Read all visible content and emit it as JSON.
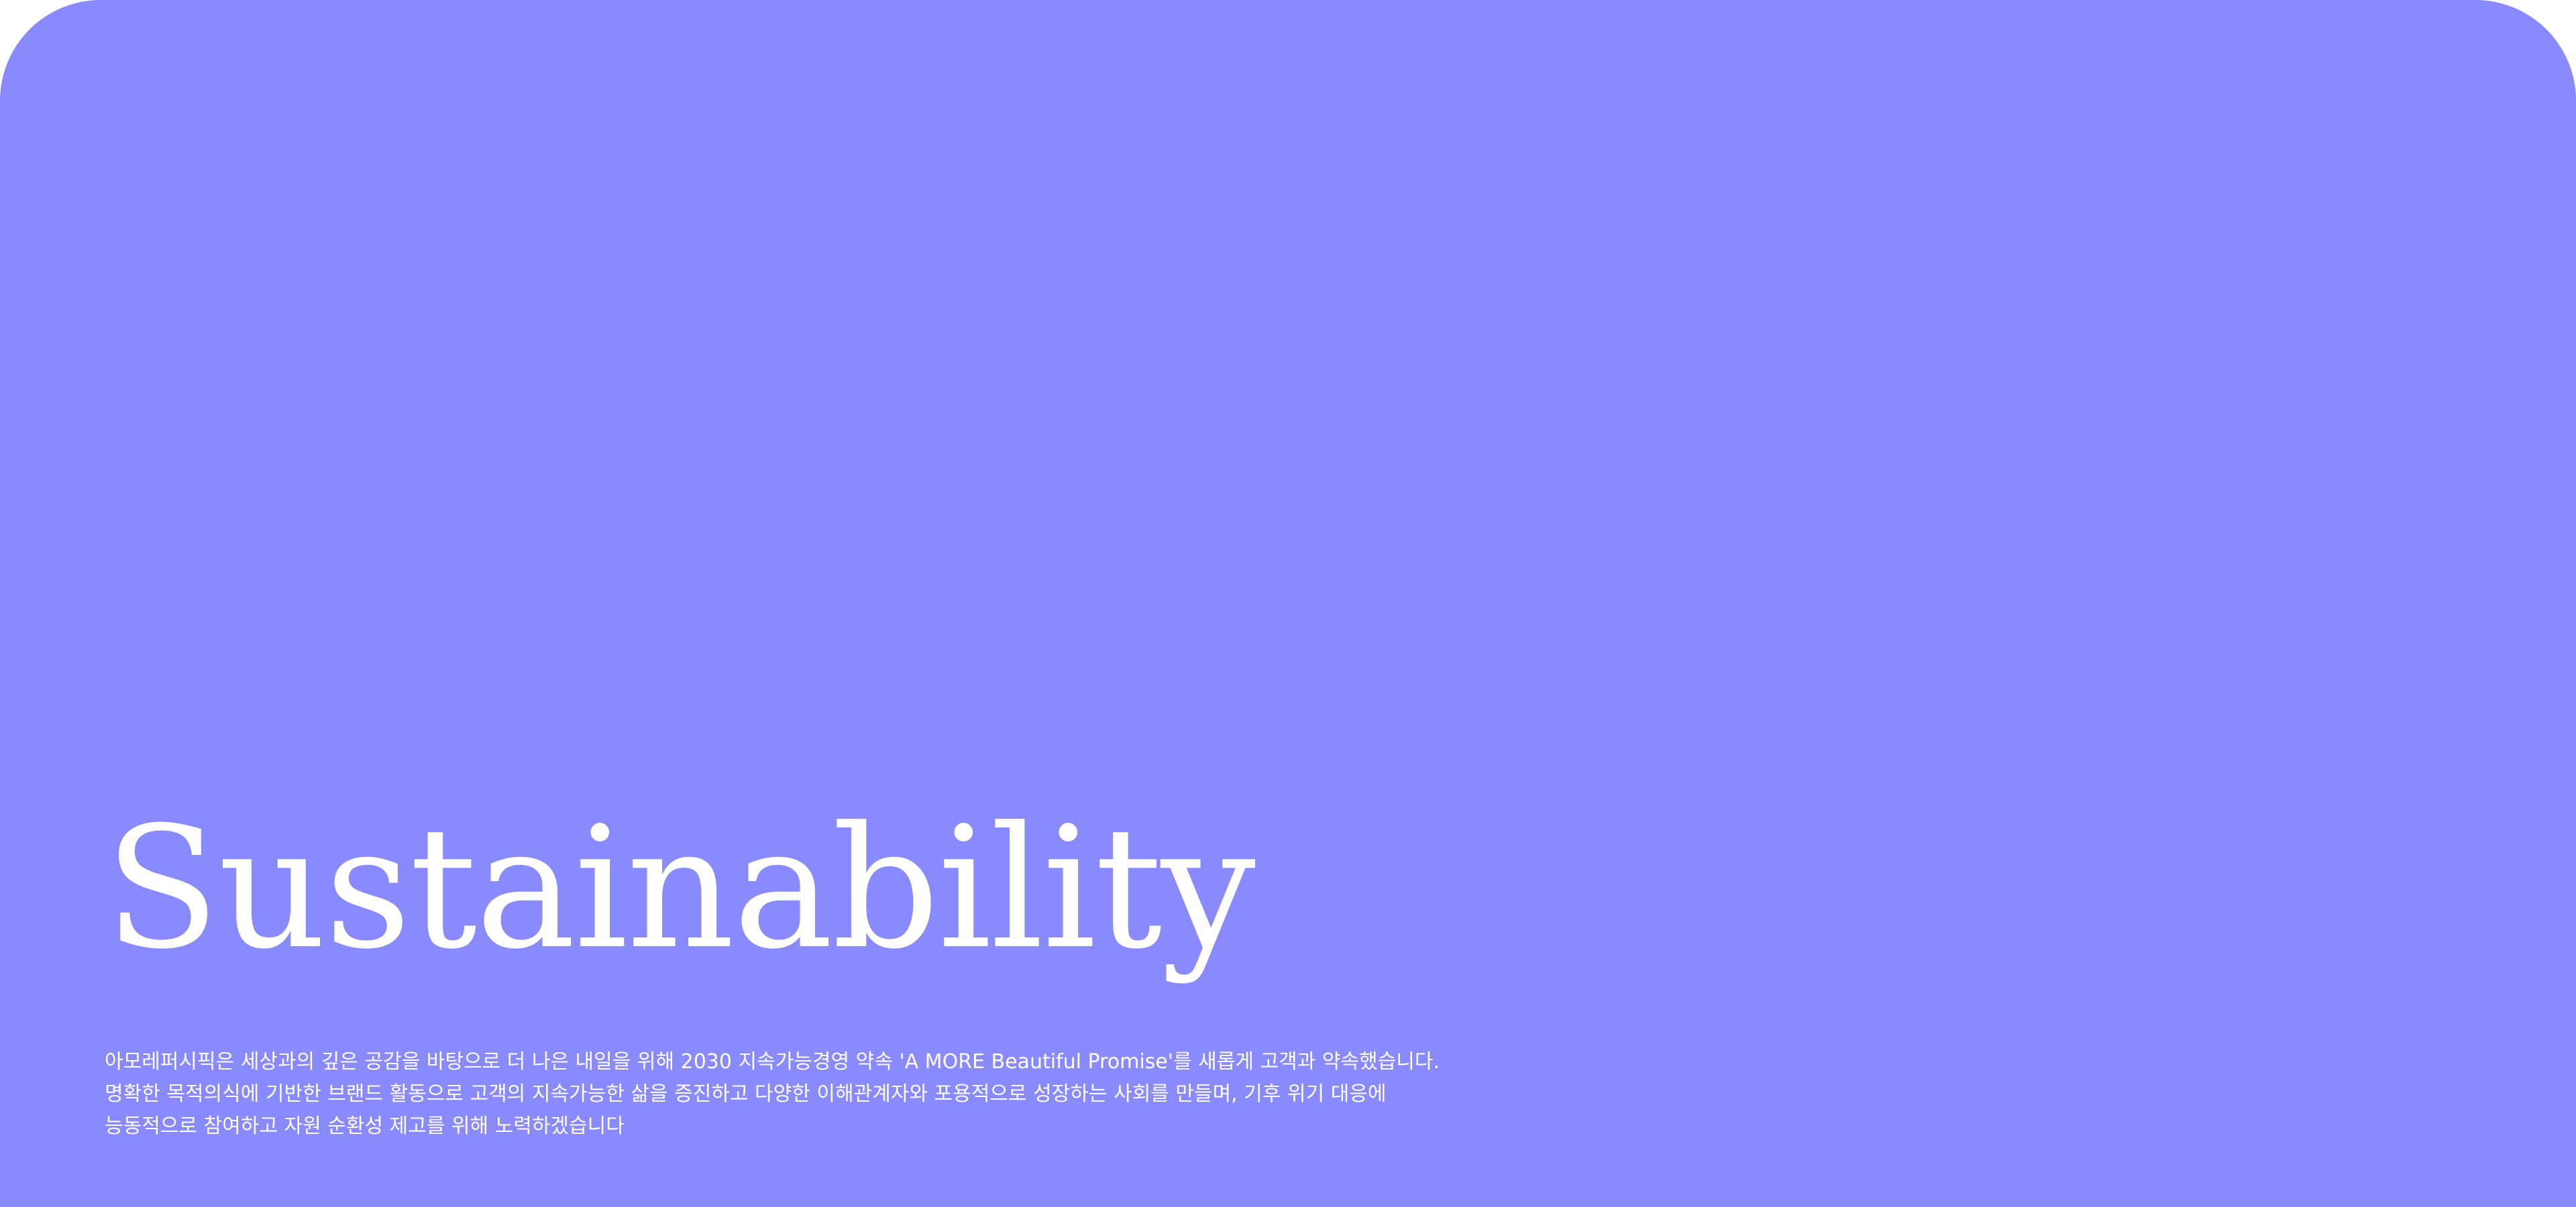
{
  "hero": {
    "background_color": "#8a8aff",
    "title": "Sustainability",
    "description_lines": [
      "아모레퍼시픽은 세상과의 깊은 공감을 바탕으로 더 나은 내일을 위해 2030 지속가능경영 약속 'A MORE Beautiful Promise'를 새롭게 고객과 약속했습니다.",
      "명확한 목적의식에 기반한 브랜드 활동으로 고객의 지속가능한 삶을 증진하고 다양한 이해관계자와 포용적으로 성장하는 사회를 만들며, 기후 위기 대응에",
      "능동적으로 참여하고 자원 순환성 제고를 위해 노력하겠습니다"
    ]
  }
}
